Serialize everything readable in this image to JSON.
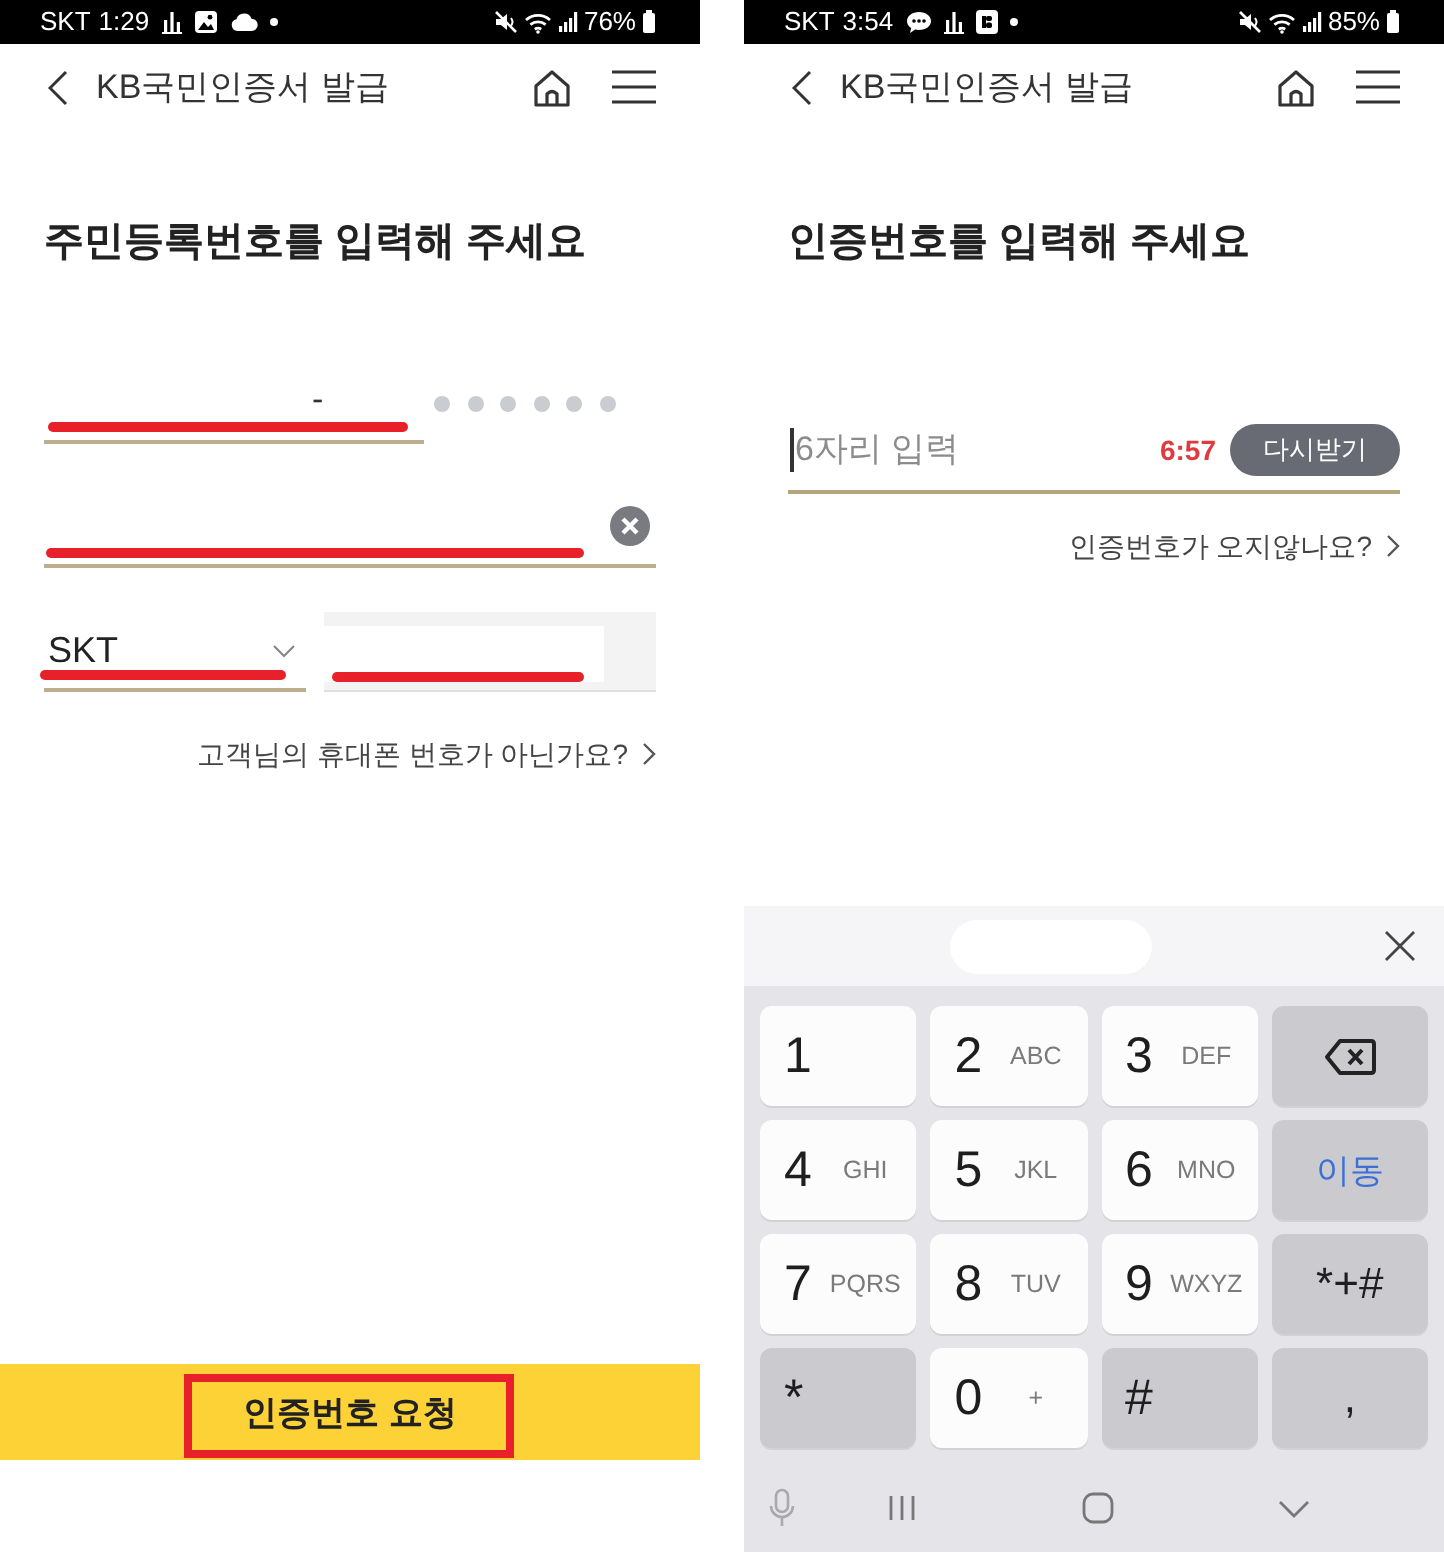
{
  "screens": [
    {
      "kind": "identity",
      "status_bar": {
        "carrier": "SKT",
        "time": "1:29",
        "notifications": [
          {
            "kind": "bars"
          },
          {
            "kind": "picture"
          },
          {
            "kind": "cloud"
          },
          {
            "kind": "dot"
          }
        ],
        "battery": "76%"
      },
      "header": {
        "title": "KB국민인증서 발급"
      },
      "heading": "주민등록번호를 입력해 주세요",
      "resident_number": {
        "separator": "-",
        "redacted": true,
        "back_masked": true
      },
      "field_2": {
        "redacted": true,
        "clearable": true
      },
      "carrier_select": {
        "value": "SKT",
        "redacted": true
      },
      "phone_field": {
        "redacted": true
      },
      "help_link": "고객님의 휴대폰 번호가 아닌가요?",
      "submit_button": {
        "label": "인증번호 요청",
        "highlighted": true
      }
    },
    {
      "kind": "verification",
      "status_bar": {
        "carrier": "SKT",
        "time": "3:54",
        "notifications": [
          {
            "kind": "chat"
          },
          {
            "kind": "bars"
          },
          {
            "kind": "badge"
          },
          {
            "kind": "dot"
          }
        ],
        "battery": "85%"
      },
      "header": {
        "title": "KB국민인증서 발급"
      },
      "heading": "인증번호를 입력해 주세요",
      "code_field": {
        "placeholder": "6자리 입력",
        "focused": true,
        "timer": "6:57",
        "resend_button": "다시받기"
      },
      "help_link": "인증번호가 오지않나요?",
      "keyboard": {
        "keys": [
          {
            "kind": "digit",
            "label": "1"
          },
          {
            "kind": "digit",
            "label": "2",
            "letters": "ABC"
          },
          {
            "kind": "digit",
            "label": "3",
            "letters": "DEF"
          },
          {
            "kind": "backspace"
          },
          {
            "kind": "digit",
            "label": "4",
            "letters": "GHI"
          },
          {
            "kind": "digit",
            "label": "5",
            "letters": "JKL"
          },
          {
            "kind": "digit",
            "label": "6",
            "letters": "MNO"
          },
          {
            "kind": "action",
            "label": "이동"
          },
          {
            "kind": "digit",
            "label": "7",
            "letters": "PQRS"
          },
          {
            "kind": "digit",
            "label": "8",
            "letters": "TUV"
          },
          {
            "kind": "digit",
            "label": "9",
            "letters": "WXYZ"
          },
          {
            "kind": "function",
            "label": "*+#"
          },
          {
            "kind": "symbol",
            "label": "*"
          },
          {
            "kind": "digit",
            "label": "0",
            "letters": "+"
          },
          {
            "kind": "symbol",
            "label": "#"
          },
          {
            "kind": "function",
            "label": ","
          }
        ]
      }
    }
  ]
}
